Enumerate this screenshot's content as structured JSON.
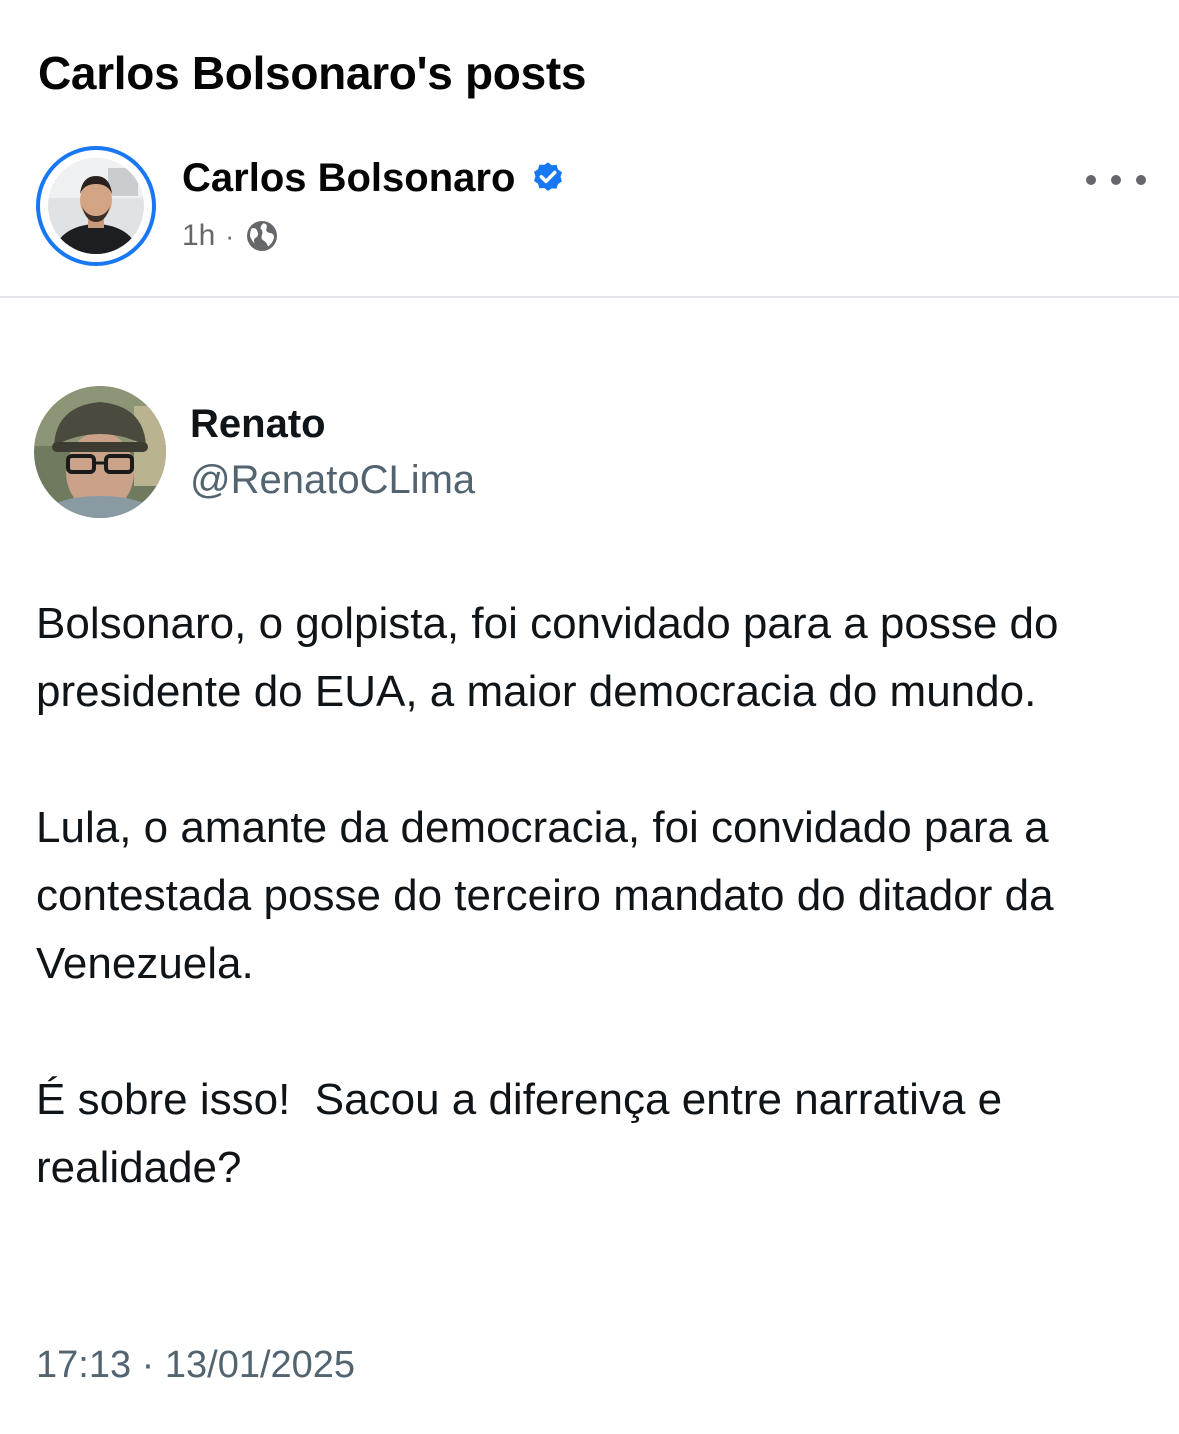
{
  "page": {
    "title": "Carlos Bolsonaro's posts"
  },
  "post": {
    "author_name": "Carlos Bolsonaro",
    "time_ago": "1h",
    "separator": "·",
    "audience_icon": "globe-icon",
    "verified_icon": "verified-badge-icon",
    "more_icon": "more-options-icon",
    "accent_color": "#1877f2"
  },
  "tweet": {
    "name": "Renato",
    "handle": "@RenatoCLima",
    "paragraphs": [
      "Bolsonaro, o golpista, foi convidado para a posse do presidente do EUA, a maior democracia do mundo.",
      "Lula, o amante da democracia, foi convidado para a contestada posse do terceiro mandato do ditador da Venezuela.",
      "É sobre isso!  Sacou a diferença entre narrativa e realidade?"
    ],
    "timestamp": "17:13 · 13/01/2025"
  }
}
